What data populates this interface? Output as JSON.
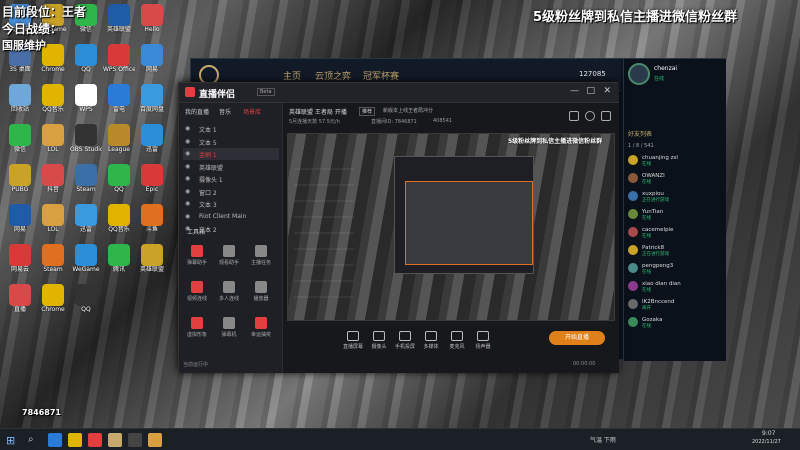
{
  "overlay": {
    "rank_line": "目前段位：王者",
    "today_line": "今日战绩：",
    "server_line": "国服维护",
    "banner": "5级粉丝牌到私信主播进微信粉丝群",
    "id_badge": "7846871"
  },
  "desktop_icons": [
    {
      "label": "此电脑",
      "color": "#4a8fd8"
    },
    {
      "label": "WeGame",
      "color": "#c9a227"
    },
    {
      "label": "微信",
      "color": "#2fb64b"
    },
    {
      "label": "英雄联盟",
      "color": "#1f5ca8"
    },
    {
      "label": "Hello",
      "color": "#d84a4a"
    },
    {
      "label": "3S 桌面",
      "color": "#4a6fa8"
    },
    {
      "label": "Chrome",
      "color": "#e0b400"
    },
    {
      "label": "QQ",
      "color": "#2a8fd8"
    },
    {
      "label": "WPS Office",
      "color": "#d83a3a"
    },
    {
      "label": "网易",
      "color": "#3a8ad8"
    },
    {
      "label": "回收站",
      "color": "#6fa8d8"
    },
    {
      "label": "QQ音乐",
      "color": "#e0b400"
    },
    {
      "label": "WPS",
      "color": "#ffffff"
    },
    {
      "label": "雷电",
      "color": "#2a7ad8"
    },
    {
      "label": "百度网盘",
      "color": "#3a9ae0"
    },
    {
      "label": "微信",
      "color": "#2fb64b"
    },
    {
      "label": "LOL",
      "color": "#d8a040"
    },
    {
      "label": "OBS Studio",
      "color": "#333333"
    },
    {
      "label": "League",
      "color": "#b88a2a"
    },
    {
      "label": "迅雷",
      "color": "#2a8fd8"
    },
    {
      "label": "PUBG",
      "color": "#c9a227"
    },
    {
      "label": "抖音",
      "color": "#d84a4a"
    },
    {
      "label": "Steam",
      "color": "#3a6fa8"
    },
    {
      "label": "QQ",
      "color": "#2fb64b"
    },
    {
      "label": "Epic",
      "color": "#d83a3a"
    },
    {
      "label": "网易",
      "color": "#1f5ca8"
    },
    {
      "label": "LOL",
      "color": "#d8a040"
    },
    {
      "label": "迅雷",
      "color": "#3a9ae0"
    },
    {
      "label": "QQ音乐",
      "color": "#e0b400"
    },
    {
      "label": "斗鱼",
      "color": "#e07020"
    },
    {
      "label": "网易云",
      "color": "#d83a3a"
    },
    {
      "label": "Steam",
      "color": "#e07020"
    },
    {
      "label": "WeGame",
      "color": "#2a8fd8"
    },
    {
      "label": "腾讯",
      "color": "#2fb64b"
    },
    {
      "label": "英雄联盟",
      "color": "#c9a227"
    },
    {
      "label": "直播",
      "color": "#d84a4a"
    },
    {
      "label": "Chrome",
      "color": "#e0b400"
    },
    {
      "label": "QQ",
      "color": "#333333"
    }
  ],
  "lol_client": {
    "nav": [
      "主页",
      "云顶之弈",
      "冠军杯赛"
    ],
    "currency": "127085",
    "username": "chenzai",
    "status": "在线",
    "section_label": "好友列表",
    "group_label": "1 / 8 / 541",
    "friends": [
      {
        "name": "chuanjing zsl",
        "status": "在线",
        "color": "#c9a227"
      },
      {
        "name": "OWANZI",
        "status": "在线",
        "color": "#8a5a3a"
      },
      {
        "name": "xuxpiou",
        "status": "正在进行游戏",
        "color": "#3a6fa8"
      },
      {
        "name": "YunTian",
        "status": "在线",
        "color": "#6a8a3a"
      },
      {
        "name": "cacemelpie",
        "status": "在线",
        "color": "#a84a4a"
      },
      {
        "name": "Patrick8",
        "status": "正在进行游戏",
        "color": "#c9a227"
      },
      {
        "name": "pengpeng3",
        "status": "在线",
        "color": "#4a8a8a"
      },
      {
        "name": "xiao dian dian",
        "status": "在线",
        "color": "#8a3a8a"
      },
      {
        "name": "IK2Bnccend",
        "status": "离开",
        "color": "#6a6a6a"
      },
      {
        "name": "Gozaka",
        "status": "在线",
        "color": "#3a8a5a"
      }
    ],
    "time": "9:07",
    "date": "2022/11/27"
  },
  "stream_app": {
    "title": "直播伴侣",
    "version": "Beta",
    "tabs": [
      "我的直播",
      "音乐",
      "场景库"
    ],
    "layers": [
      "文本 1",
      "文本 5",
      "金刷 1",
      "英雄联盟",
      "摄像头 1",
      "窗口 2",
      "文本 3",
      "Riot Client Main",
      "文本 2"
    ],
    "tools_label": "工具箱",
    "tools": [
      {
        "label": "弹幕助手",
        "color": "#e04040"
      },
      {
        "label": "观看助手",
        "color": "#888888"
      },
      {
        "label": "主播任务",
        "color": "#888888"
      },
      {
        "label": "视频连线",
        "color": "#e04040"
      },
      {
        "label": "多人连线",
        "color": "#888888"
      },
      {
        "label": "播放器",
        "color": "#888888"
      },
      {
        "label": "虚拟形象",
        "color": "#e04040"
      },
      {
        "label": "弹幕机",
        "color": "#888888"
      },
      {
        "label": "幸运抽奖",
        "color": "#e04040"
      }
    ],
    "tip": "当前运行中",
    "info": {
      "title": "英雄联盟 王者局 开播",
      "tag": "推荐",
      "subtitle": "新版本上线王者局冲分",
      "meta1": "5月连播天数 57.5元/h",
      "meta2": "直播间ID: 7846871",
      "meta3": "408541"
    },
    "overlay_banner": "5级粉丝牌到私信主播进微信粉丝群",
    "controls": [
      "直播屏幕",
      "摄像头",
      "手机投屏",
      "多媒体",
      "麦克风",
      "扬声器"
    ],
    "start_button": "开始直播",
    "timer": "00:00:00"
  },
  "taskbar": {
    "weather": "气温 下雨",
    "time": "9:07",
    "date": "2022/11/27"
  }
}
